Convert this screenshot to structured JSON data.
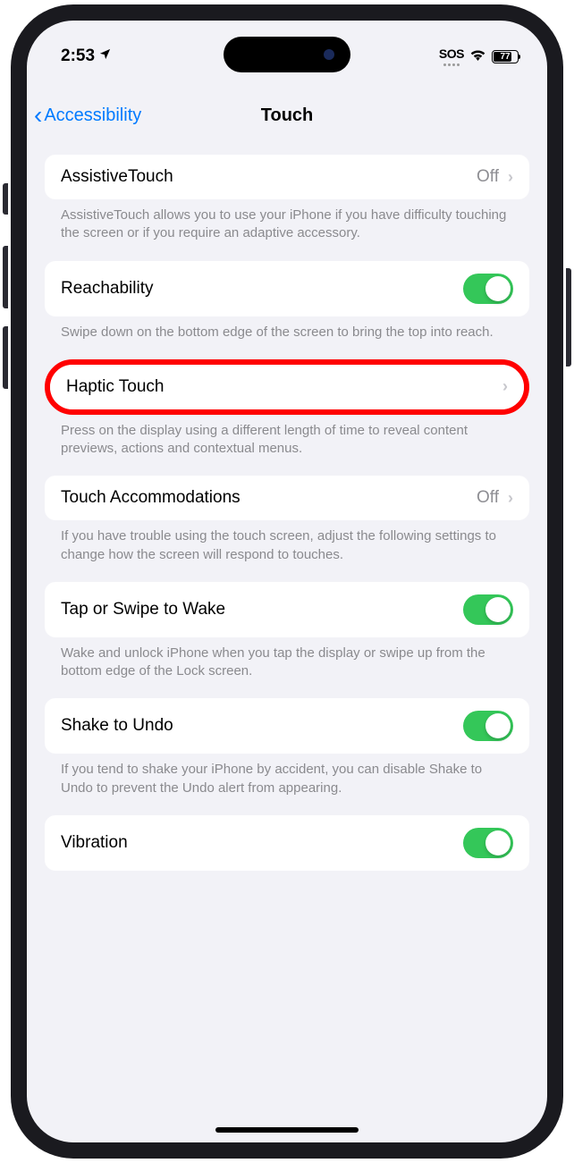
{
  "status": {
    "time": "2:53",
    "sos": "SOS",
    "battery_pct": "77"
  },
  "nav": {
    "back_label": "Accessibility",
    "title": "Touch"
  },
  "rows": {
    "assistive": {
      "label": "AssistiveTouch",
      "value": "Off",
      "footer": "AssistiveTouch allows you to use your iPhone if you have difficulty touching the screen or if you require an adaptive accessory."
    },
    "reachability": {
      "label": "Reachability",
      "footer": "Swipe down on the bottom edge of the screen to bring the top into reach."
    },
    "haptic": {
      "label": "Haptic Touch",
      "footer": "Press on the display using a different length of time to reveal content previews, actions and contextual menus."
    },
    "accommodations": {
      "label": "Touch Accommodations",
      "value": "Off",
      "footer": "If you have trouble using the touch screen, adjust the following settings to change how the screen will respond to touches."
    },
    "tapwake": {
      "label": "Tap or Swipe to Wake",
      "footer": "Wake and unlock iPhone when you tap the display or swipe up from the bottom edge of the Lock screen."
    },
    "shake": {
      "label": "Shake to Undo",
      "footer": "If you tend to shake your iPhone by accident, you can disable Shake to Undo to prevent the Undo alert from appearing."
    },
    "vibration": {
      "label": "Vibration"
    }
  }
}
